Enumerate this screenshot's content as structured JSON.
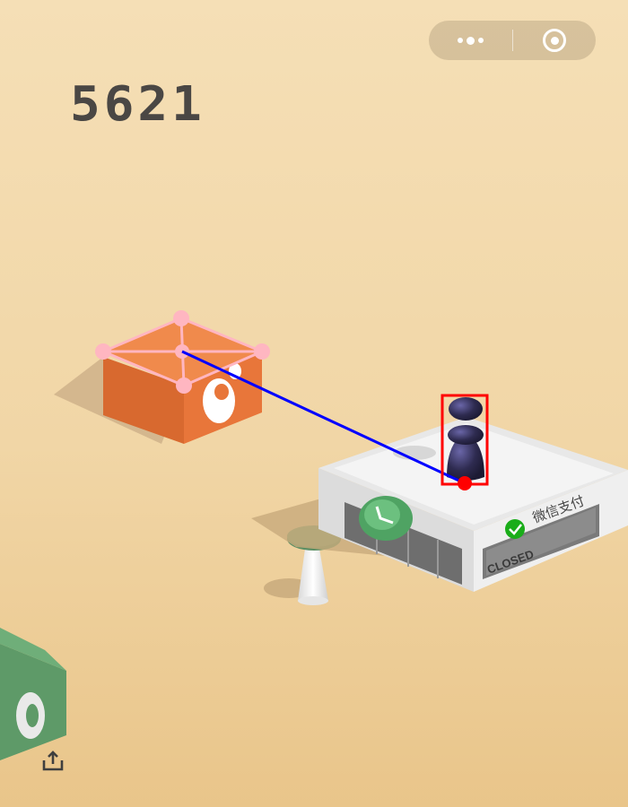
{
  "hud": {
    "score": "5621",
    "menu_icon": "more-dots-icon",
    "close_icon": "target-circle-icon",
    "share_icon": "share-upload-icon"
  },
  "scene": {
    "store": {
      "brand_label": "微信支付",
      "door_sign": "CLOSED"
    },
    "colors": {
      "background": "#f2d8a9",
      "orange_box": "#e8763a",
      "player": "#2e2b50",
      "store_roof": "#e6e6e6",
      "green_block": "#5e9a68",
      "stool_seat": "#5c8f64",
      "wechat_green": "#1aad19"
    }
  },
  "overlay": {
    "color_box": "#ff0000",
    "color_line": "#0000ff",
    "color_markers": "#ffb6c1"
  }
}
